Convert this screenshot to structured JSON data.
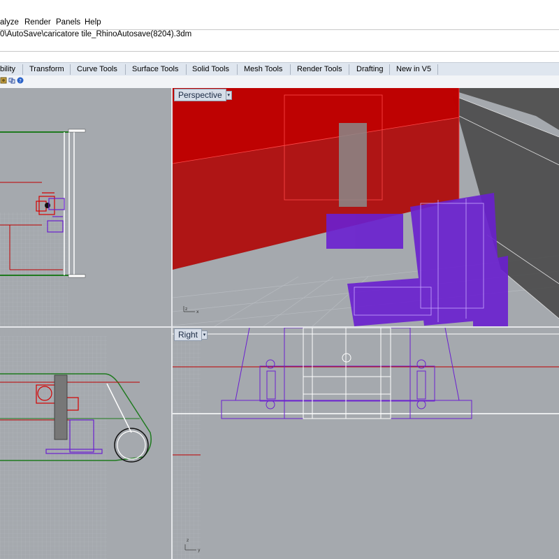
{
  "menu": {
    "items": [
      "alyze",
      "Render",
      "Panels",
      "Help"
    ]
  },
  "command_line": {
    "path": "0\\AutoSave\\caricatore tile_RhinoAutosave(8204).3dm"
  },
  "toolbar_tabs": [
    "bility",
    "Transform",
    "Curve Tools",
    "Surface Tools",
    "Solid Tools",
    "Mesh Tools",
    "Render Tools",
    "Drafting",
    "New in V5"
  ],
  "viewports": {
    "perspective": {
      "label": "Perspective",
      "menu_arrow": "▾"
    },
    "right": {
      "label": "Right",
      "menu_arrow": "▾"
    }
  },
  "axis_labels": {
    "x": "x",
    "y": "y",
    "z": "z"
  },
  "icons": [
    "settings-icon",
    "snap-icon",
    "help-icon"
  ],
  "colors": {
    "viewport_bg": "#a5a9ae",
    "red_object": "#c00000",
    "purple_object": "#6a1fd0",
    "green_curve": "#1f7a1f"
  }
}
